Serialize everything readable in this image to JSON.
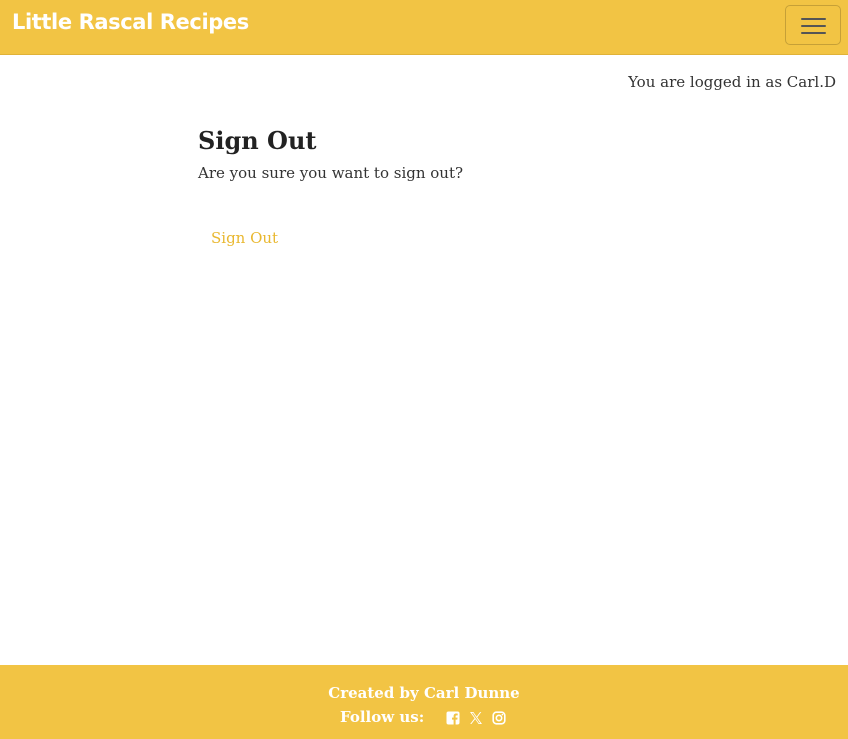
{
  "header": {
    "brand": "Little Rascal Recipes",
    "menu_icon": "hamburger-menu-icon"
  },
  "user": {
    "logged_in_text": "You are logged in as Carl.D"
  },
  "main": {
    "title": "Sign Out",
    "question": "Are you sure you want to sign out?",
    "signout_button": "Sign Out"
  },
  "footer": {
    "credit": "Created by Carl Dunne",
    "follow_label": "Follow us:",
    "social_icons": [
      "facebook-icon",
      "x-twitter-icon",
      "instagram-icon"
    ]
  },
  "colors": {
    "brand_yellow": "#f2c444",
    "button_text": "#e9b830"
  }
}
